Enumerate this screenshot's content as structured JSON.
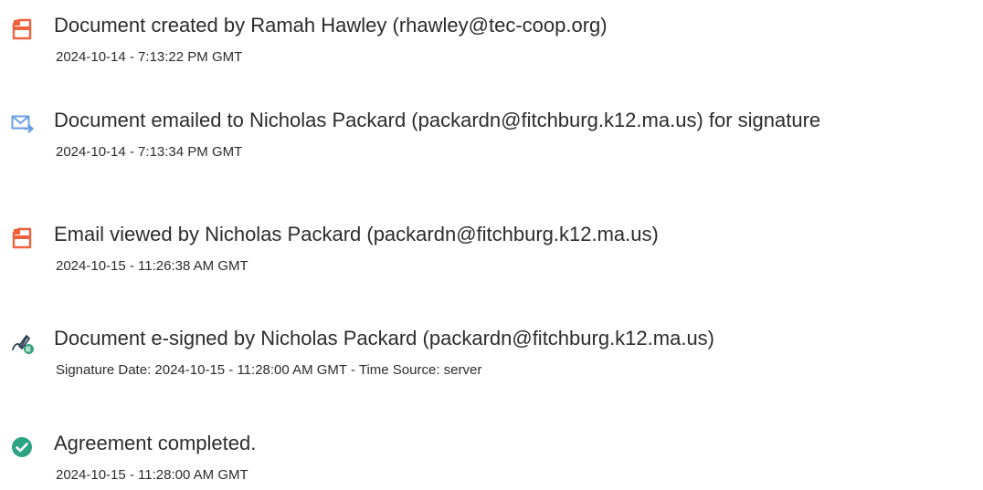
{
  "colors": {
    "document_icon": "#f0623e",
    "email_icon": "#6b9ee2",
    "sign_icon": "#39a27d",
    "complete_icon": "#2ca383",
    "text": "#2c2c2c"
  },
  "events": [
    {
      "icon": "document-icon",
      "title": "Document created by Ramah Hawley (rhawley@tec-coop.org)",
      "timestamp": "2024-10-14 - 7:13:22 PM GMT"
    },
    {
      "icon": "email-sent-icon",
      "title": "Document emailed to Nicholas Packard (packardn@fitchburg.k12.ma.us) for signature",
      "timestamp": "2024-10-14 - 7:13:34 PM GMT"
    },
    {
      "icon": "document-icon",
      "title": "Email viewed by Nicholas Packard (packardn@fitchburg.k12.ma.us)",
      "timestamp": "2024-10-15 - 11:26:38 AM GMT"
    },
    {
      "icon": "e-sign-pen-icon",
      "title": "Document e-signed by Nicholas Packard (packardn@fitchburg.k12.ma.us)",
      "timestamp": "Signature Date: 2024-10-15 - 11:28:00 AM GMT - Time Source: server"
    },
    {
      "icon": "check-circle-icon",
      "title": "Agreement completed.",
      "timestamp": "2024-10-15 - 11:28:00 AM GMT"
    }
  ]
}
